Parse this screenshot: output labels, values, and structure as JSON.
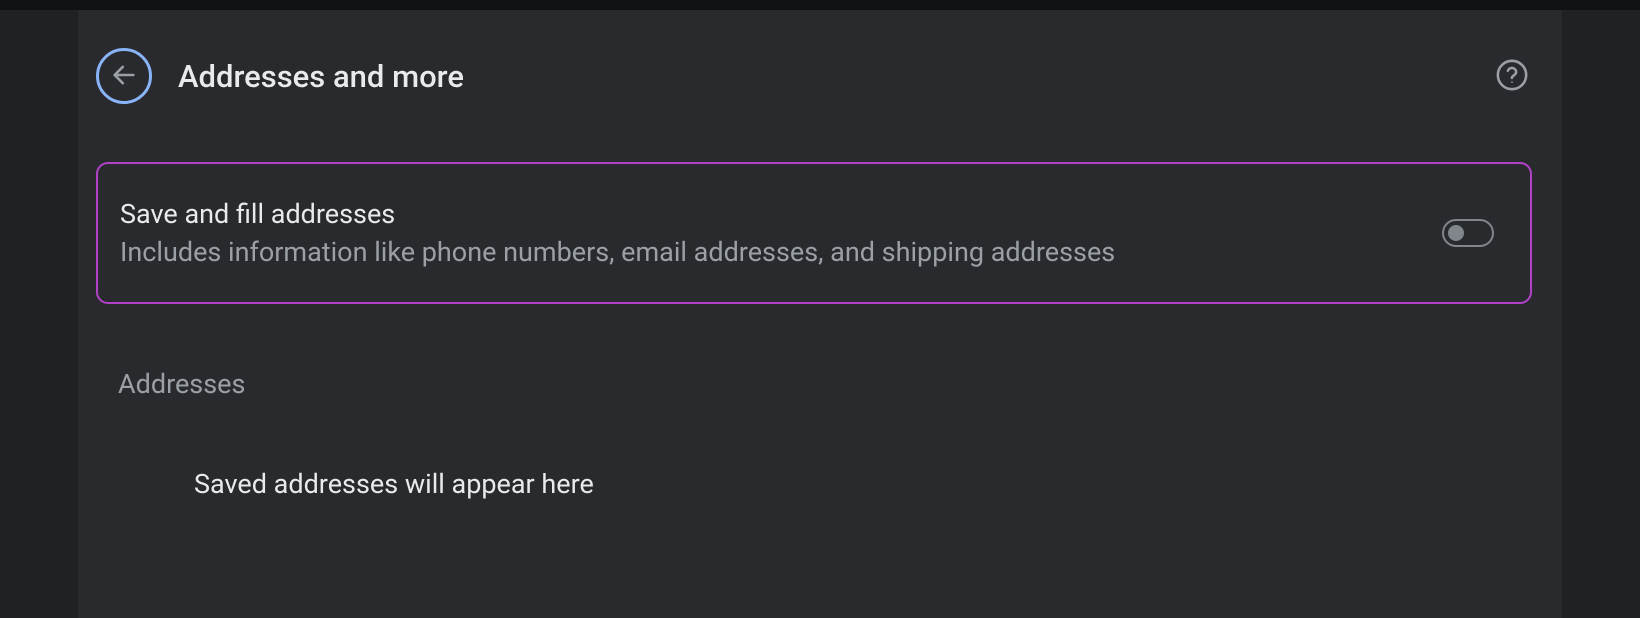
{
  "header": {
    "title": "Addresses and more"
  },
  "setting": {
    "title": "Save and fill addresses",
    "description": "Includes information like phone numbers, email addresses, and shipping addresses",
    "enabled": false
  },
  "section": {
    "label": "Addresses",
    "emptyMessage": "Saved addresses will appear here"
  }
}
